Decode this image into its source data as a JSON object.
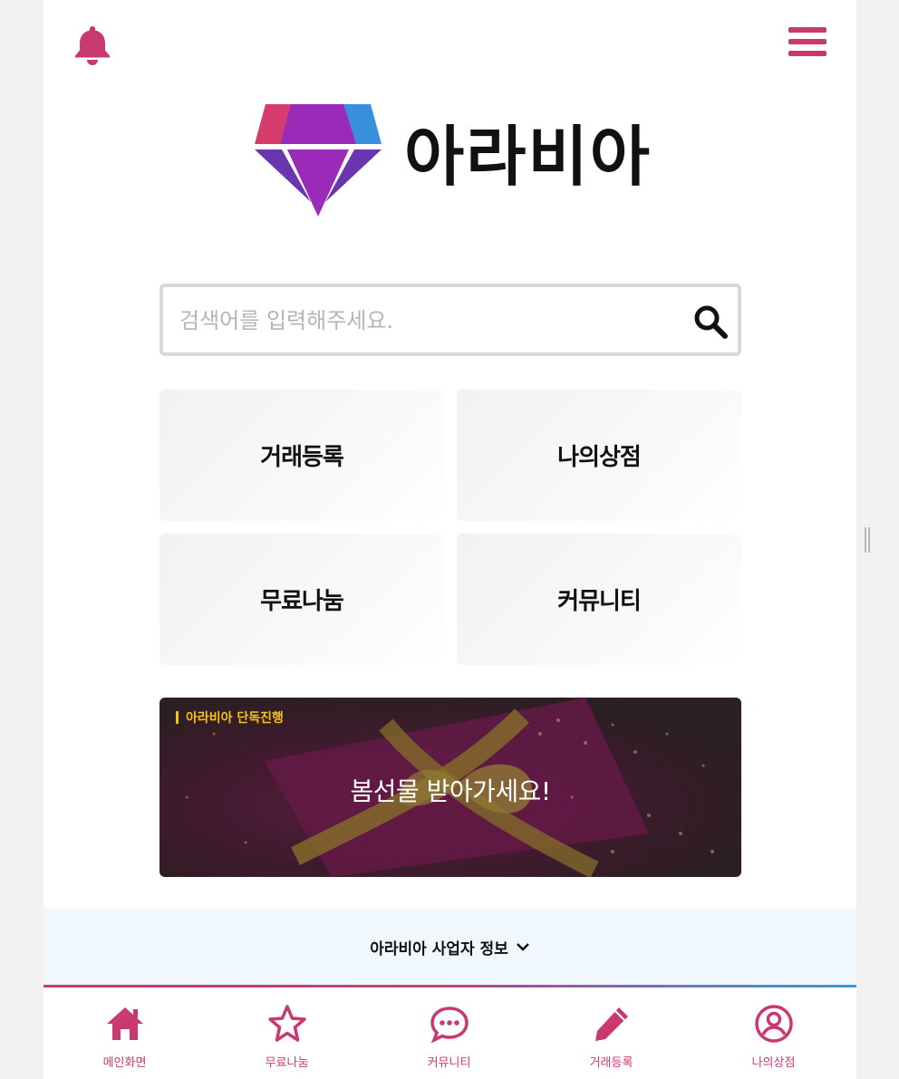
{
  "app": {
    "name": "아라비아"
  },
  "search": {
    "placeholder": "검색어를 입력해주세요."
  },
  "tiles": [
    {
      "label": "거래등록"
    },
    {
      "label": "나의상점"
    },
    {
      "label": "무료나눔"
    },
    {
      "label": "커뮤니티"
    }
  ],
  "banner": {
    "tag": "아라비아 단독진행",
    "title": "봄선물 받아가세요!"
  },
  "footer": {
    "info_label": "아라비아 사업자 정보"
  },
  "nav": {
    "items": [
      {
        "label": "메인화면",
        "icon": "home-icon"
      },
      {
        "label": "무료나눔",
        "icon": "star-icon"
      },
      {
        "label": "커뮤니티",
        "icon": "chat-icon"
      },
      {
        "label": "거래등록",
        "icon": "pencil-icon"
      },
      {
        "label": "나의상점",
        "icon": "user-circle-icon"
      }
    ]
  },
  "colors": {
    "accent": "#c9386f",
    "gem_purple": "#9a2bb8",
    "gem_pink": "#d63d6d",
    "gem_blue": "#3a8fdc",
    "footer_bg": "#f0f7fd"
  }
}
